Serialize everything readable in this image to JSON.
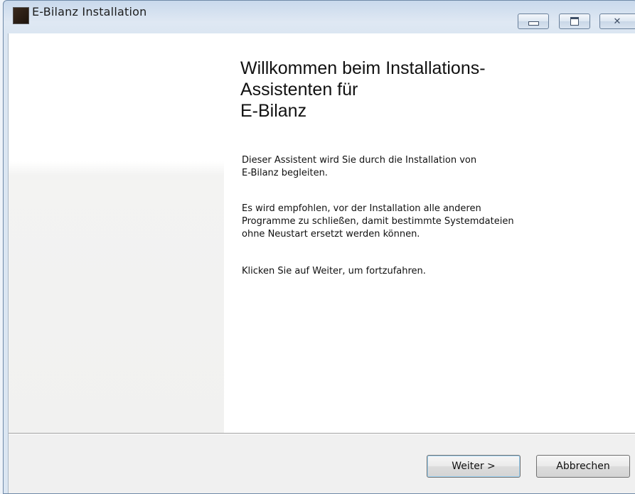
{
  "window": {
    "title": "E-Bilanz Installation"
  },
  "caption_buttons": {
    "minimize_icon": "minimize-icon",
    "maximize_icon": "maximize-icon",
    "close_icon": "close-icon",
    "close_glyph": "✕"
  },
  "main": {
    "heading_lines": [
      "Willkommen beim Installations-",
      "Assistenten für",
      "E-Bilanz"
    ],
    "paragraph1": [
      "Dieser Assistent wird Sie durch die Installation von",
      "E-Bilanz begleiten."
    ],
    "paragraph2": [
      "Es wird empfohlen, vor der Installation alle anderen",
      "Programme zu schließen, damit bestimmte Systemdateien",
      "ohne Neustart ersetzt werden können."
    ],
    "paragraph3": [
      "Klicken Sie auf Weiter, um fortzufahren."
    ]
  },
  "buttons": {
    "next_label": "Weiter >",
    "cancel_label": "Abbrechen"
  }
}
